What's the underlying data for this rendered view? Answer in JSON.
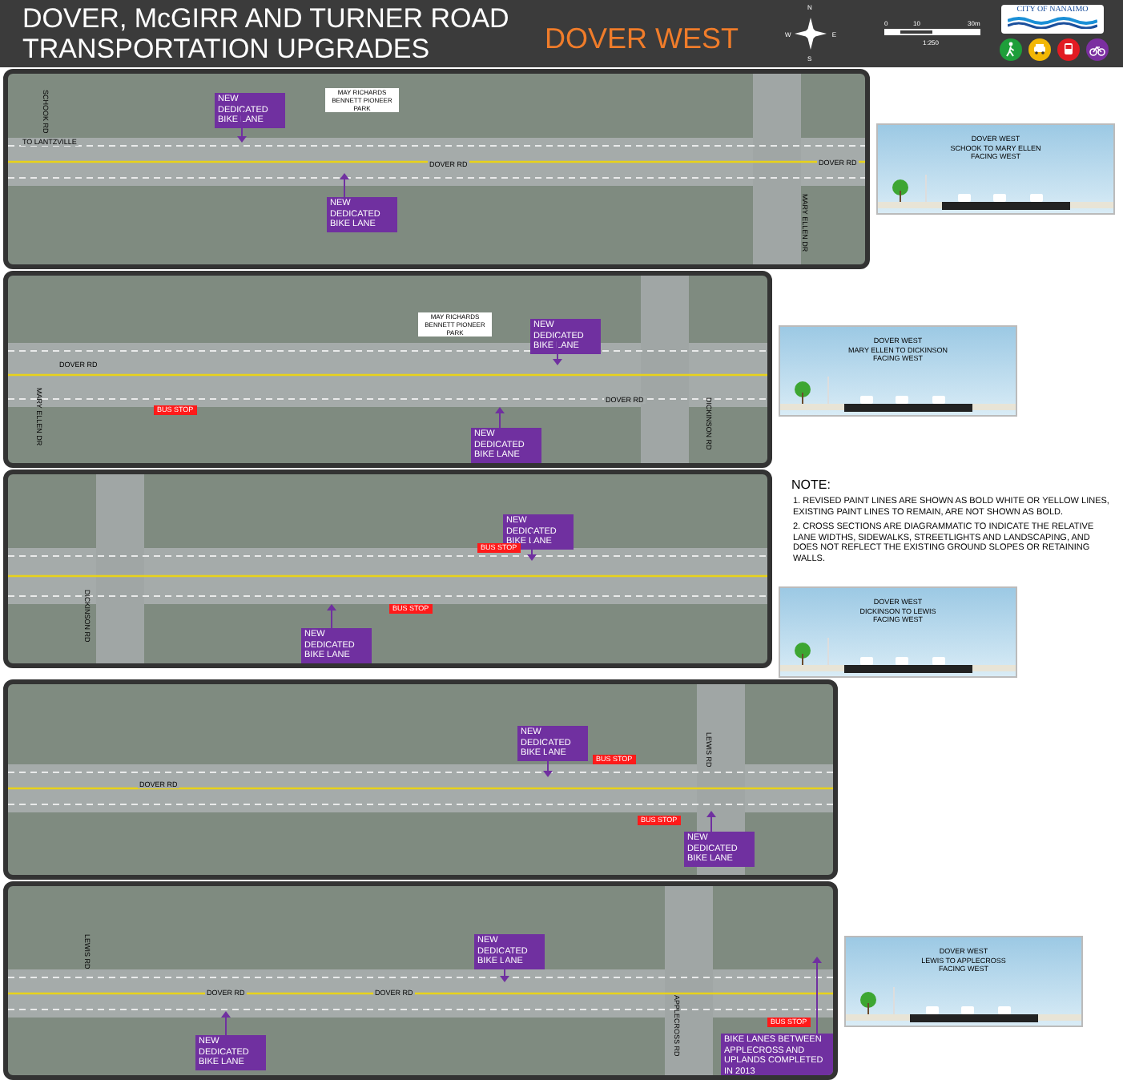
{
  "header": {
    "title_lines": [
      "DOVER, McGIRR AND TURNER ROAD",
      "TRANSPORTATION UPGRADES"
    ],
    "section": "DOVER WEST",
    "compass": {
      "n": "N",
      "s": "S",
      "e": "E",
      "w": "W"
    },
    "scale": {
      "ticks": [
        "0",
        "10",
        "30m"
      ],
      "ratio": "1:250"
    },
    "logo": "CITY OF NANAIMO",
    "modes": [
      {
        "kind": "walk",
        "color": "#1e9e3a"
      },
      {
        "kind": "car",
        "color": "#f2b705"
      },
      {
        "kind": "bus",
        "color": "#e21b23"
      },
      {
        "kind": "bike",
        "color": "#7b2fa0"
      }
    ]
  },
  "panels": [
    {
      "labels": [
        {
          "kind": "road_vertical",
          "text": "SCHOOK RD"
        },
        {
          "kind": "callout",
          "text": "NEW DEDICATED BIKE LANE"
        },
        {
          "kind": "place",
          "text": "MAY RICHARDS BENNETT PIONEER PARK"
        },
        {
          "kind": "road",
          "text": "TO LANTZVILLE"
        },
        {
          "kind": "road",
          "text": "DOVER RD"
        },
        {
          "kind": "road",
          "text": "DOVER RD"
        },
        {
          "kind": "callout",
          "text": "NEW DEDICATED BIKE LANE"
        },
        {
          "kind": "road_vertical",
          "text": "MARY ELLEN DR"
        }
      ],
      "cross_section": [
        "DOVER WEST",
        "SCHOOK TO MARY ELLEN",
        "FACING WEST"
      ]
    },
    {
      "labels": [
        {
          "kind": "place",
          "text": "MAY RICHARDS BENNETT PIONEER PARK"
        },
        {
          "kind": "callout",
          "text": "NEW DEDICATED BIKE LANE"
        },
        {
          "kind": "road",
          "text": "DOVER RD"
        },
        {
          "kind": "road",
          "text": "DOVER RD"
        },
        {
          "kind": "bus_stop",
          "text": "BUS STOP"
        },
        {
          "kind": "callout",
          "text": "NEW DEDICATED BIKE LANE"
        },
        {
          "kind": "road_vertical",
          "text": "MARY ELLEN DR"
        },
        {
          "kind": "road_vertical",
          "text": "DICKINSON RD"
        }
      ],
      "cross_section": [
        "DOVER WEST",
        "MARY ELLEN TO DICKINSON",
        "FACING WEST"
      ]
    },
    {
      "labels": [
        {
          "kind": "callout",
          "text": "NEW DEDICATED BIKE LANE"
        },
        {
          "kind": "bus_stop",
          "text": "BUS STOP"
        },
        {
          "kind": "bus_stop",
          "text": "BUS STOP"
        },
        {
          "kind": "callout",
          "text": "NEW DEDICATED BIKE LANE"
        },
        {
          "kind": "road_vertical",
          "text": "DICKINSON RD"
        }
      ],
      "note": {
        "heading": "NOTE:",
        "items": [
          "1. REVISED PAINT LINES ARE SHOWN AS BOLD WHITE OR YELLOW LINES, EXISTING PAINT LINES TO REMAIN, ARE NOT SHOWN AS BOLD.",
          "2. CROSS SECTIONS ARE DIAGRAMMATIC TO INDICATE THE RELATIVE LANE WIDTHS, SIDEWALKS, STREETLIGHTS AND LANDSCAPING, AND DOES NOT REFLECT THE EXISTING GROUND SLOPES OR RETAINING WALLS."
        ]
      },
      "cross_section": [
        "DOVER WEST",
        "DICKINSON TO LEWIS",
        "FACING WEST"
      ]
    },
    {
      "labels": [
        {
          "kind": "callout",
          "text": "NEW DEDICATED BIKE LANE"
        },
        {
          "kind": "bus_stop",
          "text": "BUS STOP"
        },
        {
          "kind": "road",
          "text": "DOVER RD"
        },
        {
          "kind": "bus_stop",
          "text": "BUS STOP"
        },
        {
          "kind": "callout",
          "text": "NEW DEDICATED BIKE LANE"
        },
        {
          "kind": "road_vertical",
          "text": "LEWIS RD"
        }
      ]
    },
    {
      "labels": [
        {
          "kind": "callout",
          "text": "NEW DEDICATED BIKE LANE"
        },
        {
          "kind": "road",
          "text": "DOVER RD"
        },
        {
          "kind": "road",
          "text": "DOVER RD"
        },
        {
          "kind": "callout",
          "text": "NEW DEDICATED BIKE LANE"
        },
        {
          "kind": "bus_stop",
          "text": "BUS STOP"
        },
        {
          "kind": "callout",
          "text": "BIKE LANES BETWEEN APPLECROSS AND UPLANDS COMPLETED IN 2013"
        },
        {
          "kind": "road_vertical",
          "text": "LEWIS RD"
        },
        {
          "kind": "road_vertical",
          "text": "APPLECROSS RD"
        }
      ],
      "cross_section": [
        "DOVER WEST",
        "LEWIS TO APPLECROSS",
        "FACING WEST"
      ]
    }
  ]
}
